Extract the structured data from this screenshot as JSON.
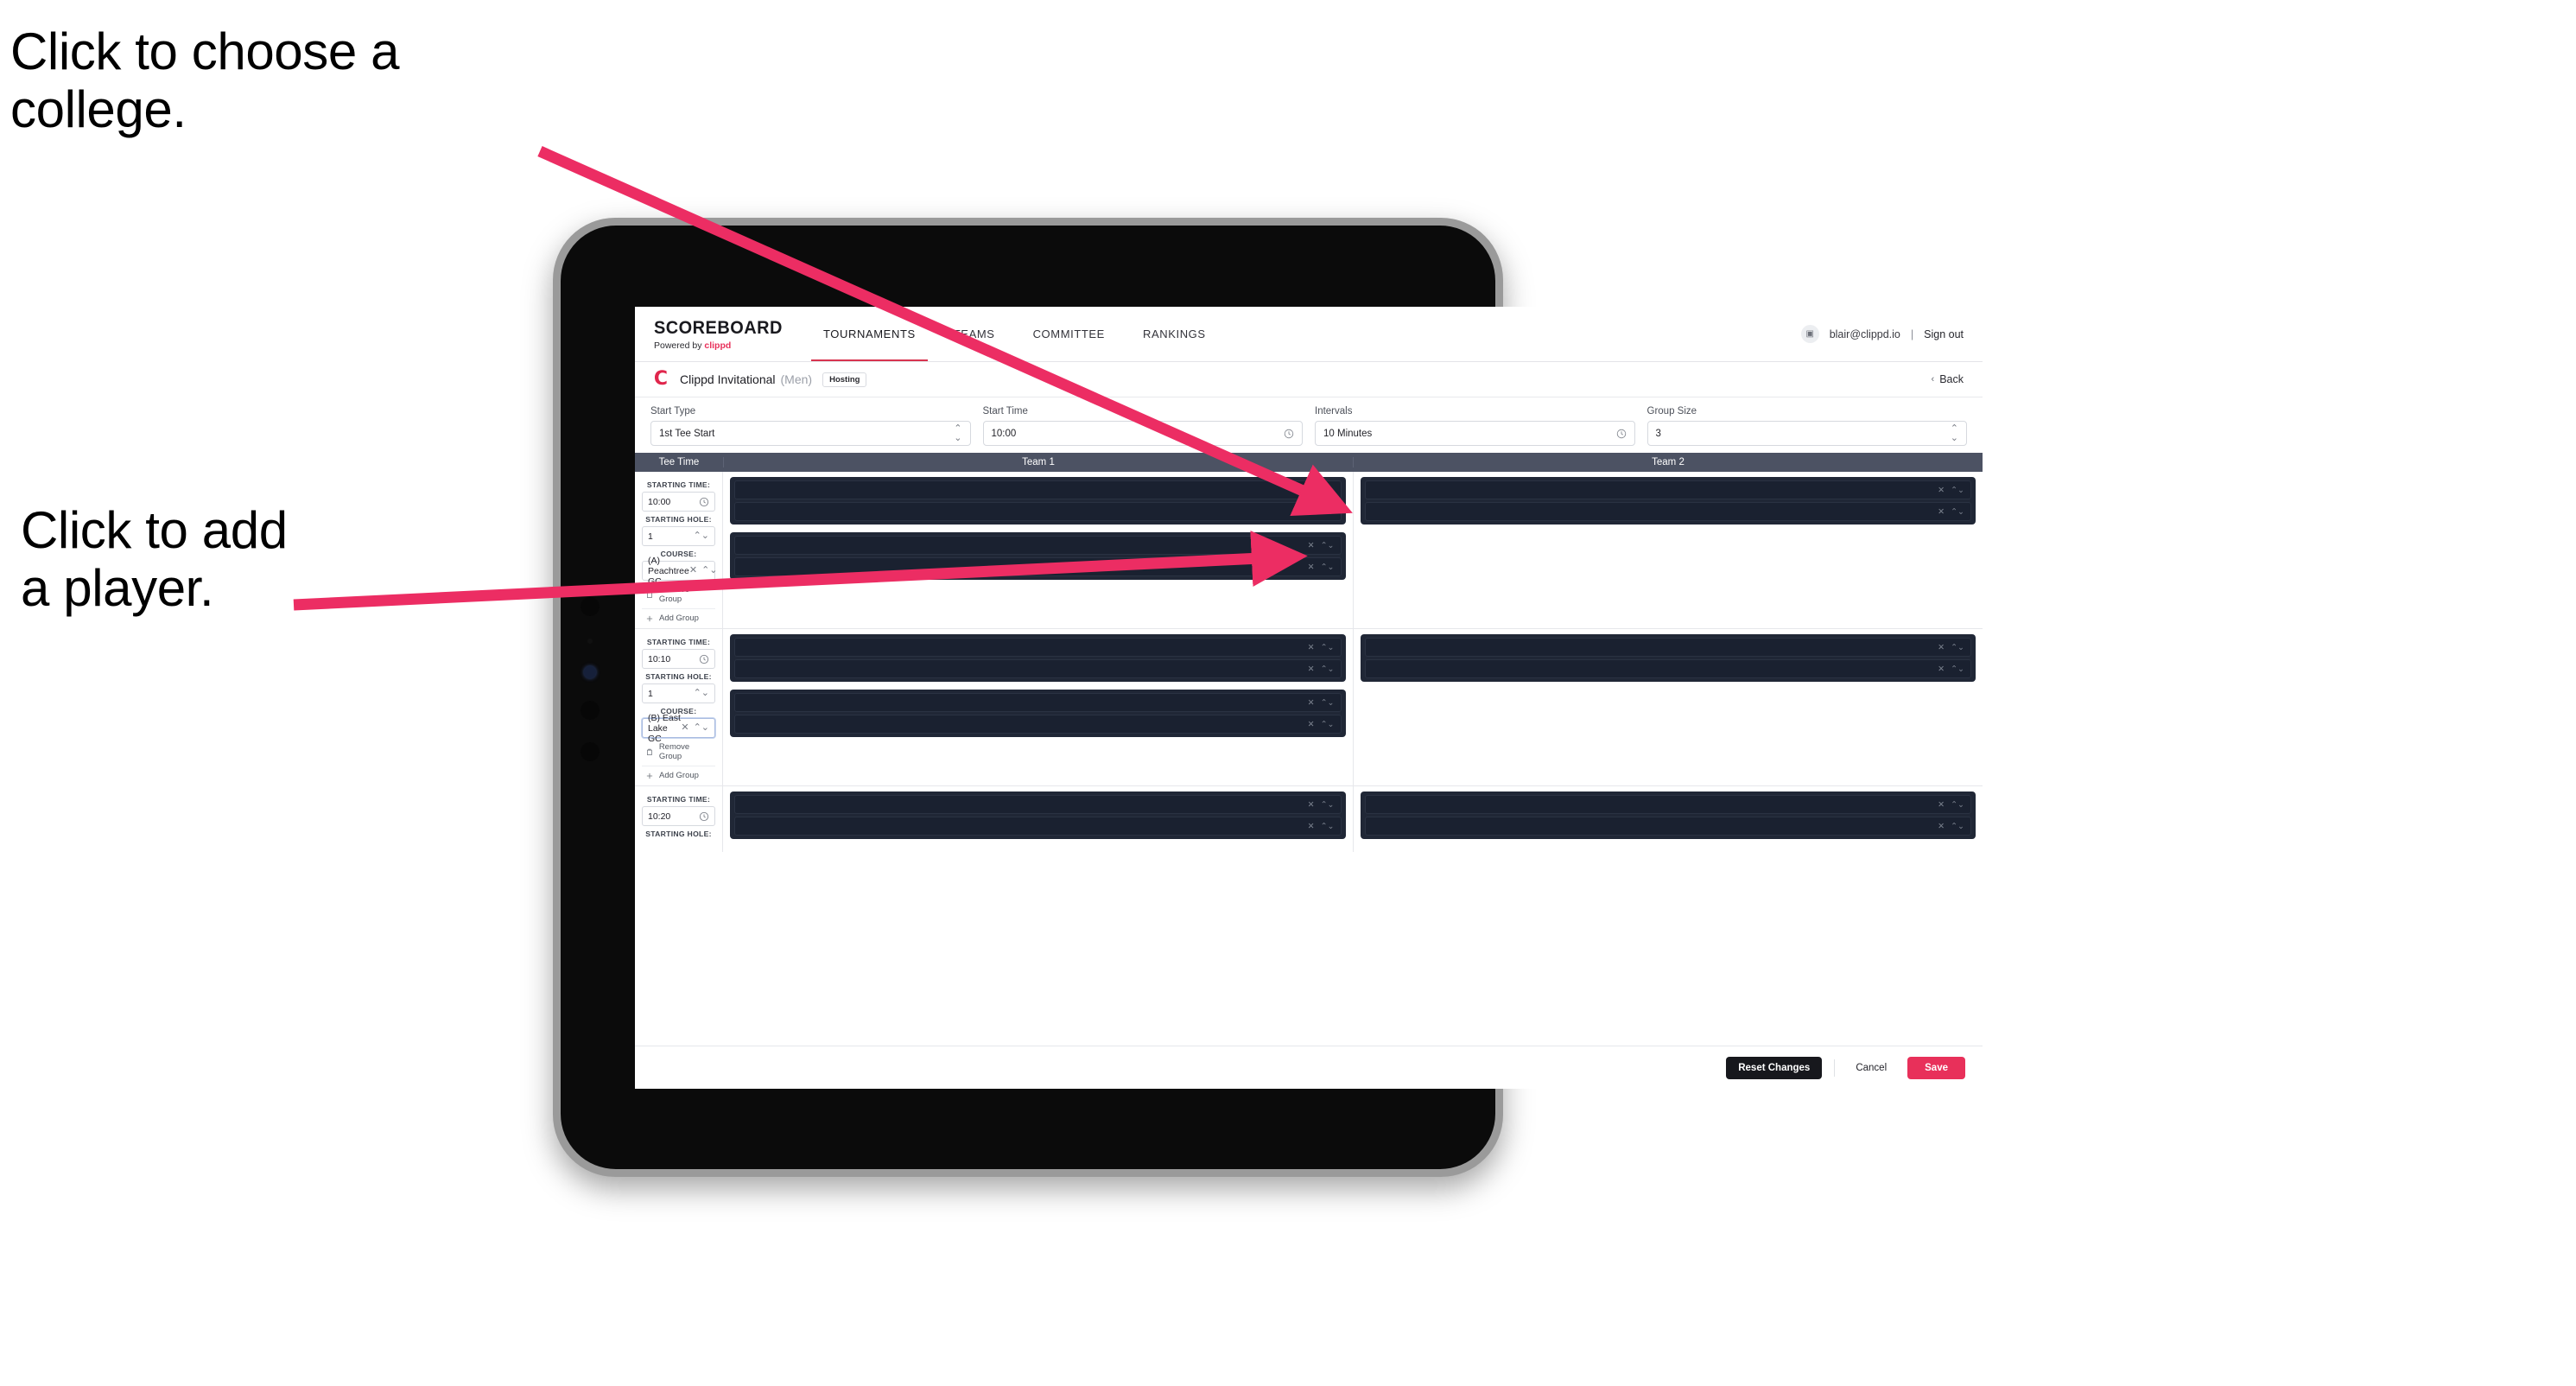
{
  "annotations": [
    {
      "id": "college",
      "text": "Click to choose a\ncollege."
    },
    {
      "id": "player",
      "text": "Click to add\na player."
    }
  ],
  "colors": {
    "accent": "#e8305a",
    "arrow": "#ec2d63",
    "header_bar": "#4c5263",
    "dark_row": "#202736"
  },
  "app": {
    "navbar": {
      "brand_title": "SCOREBOARD",
      "brand_sub_prefix": "Powered by ",
      "brand_sub_brand": "clippd",
      "tabs": [
        {
          "label": "TOURNAMENTS",
          "active": true
        },
        {
          "label": "TEAMS",
          "active": false
        },
        {
          "label": "COMMITTEE",
          "active": false
        },
        {
          "label": "RANKINGS",
          "active": false
        }
      ],
      "avatar_icon": "user-avatar-icon",
      "user_email": "blair@clippd.io",
      "separator": "|",
      "sign_out": "Sign out"
    },
    "tournament": {
      "logo_letter": "C",
      "name": "Clippd Invitational",
      "gender": "(Men)",
      "badge": "Hosting",
      "back_label": "Back",
      "back_chevron": "‹"
    },
    "filters": [
      {
        "label": "Start Type",
        "value": "1st Tee Start",
        "control": "select"
      },
      {
        "label": "Start Time",
        "value": "10:00",
        "control": "time"
      },
      {
        "label": "Intervals",
        "value": "10 Minutes",
        "control": "time"
      },
      {
        "label": "Group Size",
        "value": "3",
        "control": "select"
      }
    ],
    "table": {
      "headers": [
        "Tee Time",
        "Team 1",
        "Team 2"
      ],
      "labels": {
        "starting_time": "STARTING TIME:",
        "starting_hole": "STARTING HOLE:",
        "course": "COURSE:",
        "remove_group": "Remove Group",
        "add_group": "Add Group"
      },
      "groups": [
        {
          "starting_time": "10:00",
          "starting_hole": "1",
          "course": "(A) Peachtree GC",
          "course_focused": false,
          "team1_boxes": [
            {
              "rows": 2
            },
            {
              "rows": 2
            }
          ],
          "team2_boxes": [
            {
              "rows": 2
            }
          ]
        },
        {
          "starting_time": "10:10",
          "starting_hole": "1",
          "course": "(B) East Lake GC",
          "course_focused": true,
          "team1_boxes": [
            {
              "rows": 2
            },
            {
              "rows": 2
            }
          ],
          "team2_boxes": [
            {
              "rows": 2
            }
          ]
        },
        {
          "starting_time": "10:20",
          "starting_hole": "",
          "course": "",
          "course_focused": false,
          "team1_boxes": [
            {
              "rows": 2
            }
          ],
          "team2_boxes": [
            {
              "rows": 2
            }
          ]
        }
      ],
      "row_actions": {
        "clear": "×",
        "expand": "⌃⌄"
      }
    },
    "footer": {
      "reset_label": "Reset Changes",
      "cancel_label": "Cancel",
      "save_label": "Save"
    }
  }
}
